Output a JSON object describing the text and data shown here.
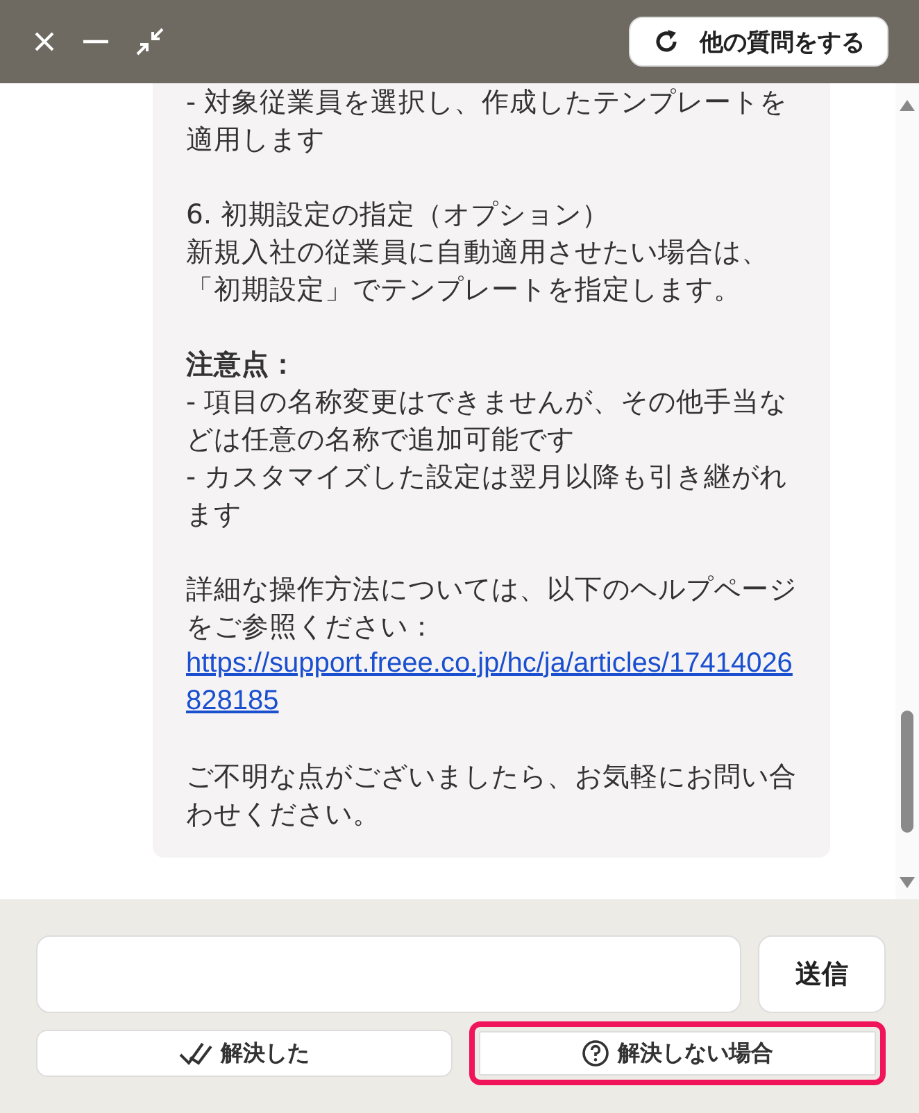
{
  "header": {
    "controls": [
      {
        "kind": "close"
      },
      {
        "kind": "minimize"
      },
      {
        "kind": "shrink"
      }
    ],
    "new_question_button": "他の質問をする"
  },
  "message": {
    "blocks": [
      {
        "kind": "text",
        "text": "- 対象従業員を選択し、作成したテンプレートを適用します"
      },
      {
        "kind": "gap"
      },
      {
        "kind": "text",
        "text": "6. 初期設定の指定（オプション）"
      },
      {
        "kind": "text",
        "text": "新規入社の従業員に自動適用させたい場合は、「初期設定」でテンプレートを指定します。"
      },
      {
        "kind": "gap"
      },
      {
        "kind": "heading",
        "text": "注意点："
      },
      {
        "kind": "text",
        "text": "- 項目の名称変更はできませんが、その他手当などは任意の名称で追加可能です"
      },
      {
        "kind": "text",
        "text": "- カスタマイズした設定は翌月以降も引き継がれます"
      },
      {
        "kind": "gap"
      },
      {
        "kind": "text",
        "text": "詳細な操作方法については、以下のヘルプページをご参照ください："
      },
      {
        "kind": "link",
        "text": "https://support.freee.co.jp/hc/ja/articles/17414026828185"
      },
      {
        "kind": "gap"
      },
      {
        "kind": "text",
        "text": "ご不明な点がございましたら、お気軽にお問い合わせください。"
      }
    ]
  },
  "composer": {
    "send_button": "送信"
  },
  "feedback_buttons": [
    {
      "kind": "resolved",
      "label": "解決した",
      "highlighted": false
    },
    {
      "kind": "unresolved",
      "label": "解決しない場合",
      "highlighted": true
    }
  ]
}
